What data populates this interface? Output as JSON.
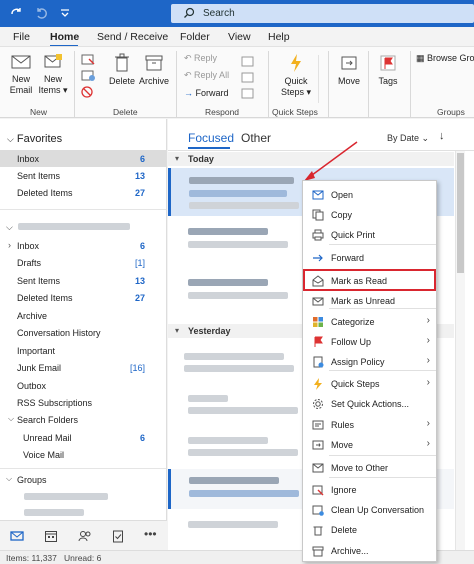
{
  "search": {
    "placeholder": "Search"
  },
  "menu": {
    "tabs": [
      "File",
      "Home",
      "Send / Receive",
      "Folder",
      "View",
      "Help"
    ]
  },
  "ribbon": {
    "new_email": "New\nEmail",
    "new_items": "New\nItems ▾",
    "delete": "Delete",
    "archive": "Archive",
    "reply": "Reply",
    "reply_all": "Reply All",
    "forward": "Forward",
    "quick_steps": "Quick\nSteps ▾",
    "move": "Move",
    "tags": "Tags",
    "browse_groups": "Browse Gro",
    "groups_new": "New",
    "groups_delete": "Delete",
    "groups_respond": "Respond",
    "groups_quick": "Quick Steps",
    "groups_groups": "Groups"
  },
  "nav": {
    "favorites_header": "Favorites",
    "favorites": [
      {
        "label": "Inbox",
        "count": "6"
      },
      {
        "label": "Sent Items",
        "count": "13"
      },
      {
        "label": "Deleted Items",
        "count": "27"
      }
    ],
    "folders": [
      {
        "label": "Inbox",
        "count": "6"
      },
      {
        "label": "Drafts",
        "count": "[1]"
      },
      {
        "label": "Sent Items",
        "count": "13"
      },
      {
        "label": "Deleted Items",
        "count": "27"
      },
      {
        "label": "Archive",
        "count": ""
      },
      {
        "label": "Conversation History",
        "count": ""
      },
      {
        "label": "Important",
        "count": ""
      },
      {
        "label": "Junk Email",
        "count": "[16]"
      },
      {
        "label": "Outbox",
        "count": ""
      },
      {
        "label": "RSS Subscriptions",
        "count": ""
      },
      {
        "label": "Search Folders",
        "count": ""
      },
      {
        "label": "Unread Mail",
        "count": "6"
      },
      {
        "label": "Voice Mail",
        "count": ""
      }
    ],
    "groups_header": "Groups"
  },
  "maillist": {
    "tab_focused": "Focused",
    "tab_other": "Other",
    "sort": "By Date ⌄",
    "group_today": "Today",
    "group_yesterday": "Yesterday"
  },
  "context_menu": [
    {
      "label": "Open",
      "icon": "open-icon",
      "submenu": false
    },
    {
      "label": "Copy",
      "icon": "copy-icon",
      "submenu": false
    },
    {
      "label": "Quick Print",
      "icon": "print-icon",
      "submenu": false
    },
    {
      "label": "Forward",
      "icon": "forward-icon",
      "submenu": false
    },
    {
      "label": "Mark as Read",
      "icon": "open-envelope-icon",
      "submenu": false
    },
    {
      "label": "Mark as Unread",
      "icon": "envelope-icon",
      "submenu": false
    },
    {
      "label": "Categorize",
      "icon": "categorize-icon",
      "submenu": true
    },
    {
      "label": "Follow Up",
      "icon": "flag-icon",
      "submenu": true
    },
    {
      "label": "Assign Policy",
      "icon": "policy-icon",
      "submenu": true
    },
    {
      "label": "Quick Steps",
      "icon": "lightning-icon",
      "submenu": true
    },
    {
      "label": "Set Quick Actions...",
      "icon": "gear-icon",
      "submenu": false
    },
    {
      "label": "Rules",
      "icon": "rules-icon",
      "submenu": true
    },
    {
      "label": "Move",
      "icon": "move-icon",
      "submenu": true
    },
    {
      "label": "Move to Other",
      "icon": "move-other-icon",
      "submenu": false
    },
    {
      "label": "Ignore",
      "icon": "ignore-icon",
      "submenu": false
    },
    {
      "label": "Clean Up Conversation",
      "icon": "cleanup-icon",
      "submenu": false
    },
    {
      "label": "Delete",
      "icon": "delete-icon",
      "submenu": false
    },
    {
      "label": "Archive...",
      "icon": "archive-icon",
      "submenu": false
    }
  ],
  "status": {
    "items": "Items: 11,337",
    "unread": "Unread: 6"
  },
  "colors": {
    "accent": "#1e66c7",
    "highlight_border": "#d9262f"
  }
}
